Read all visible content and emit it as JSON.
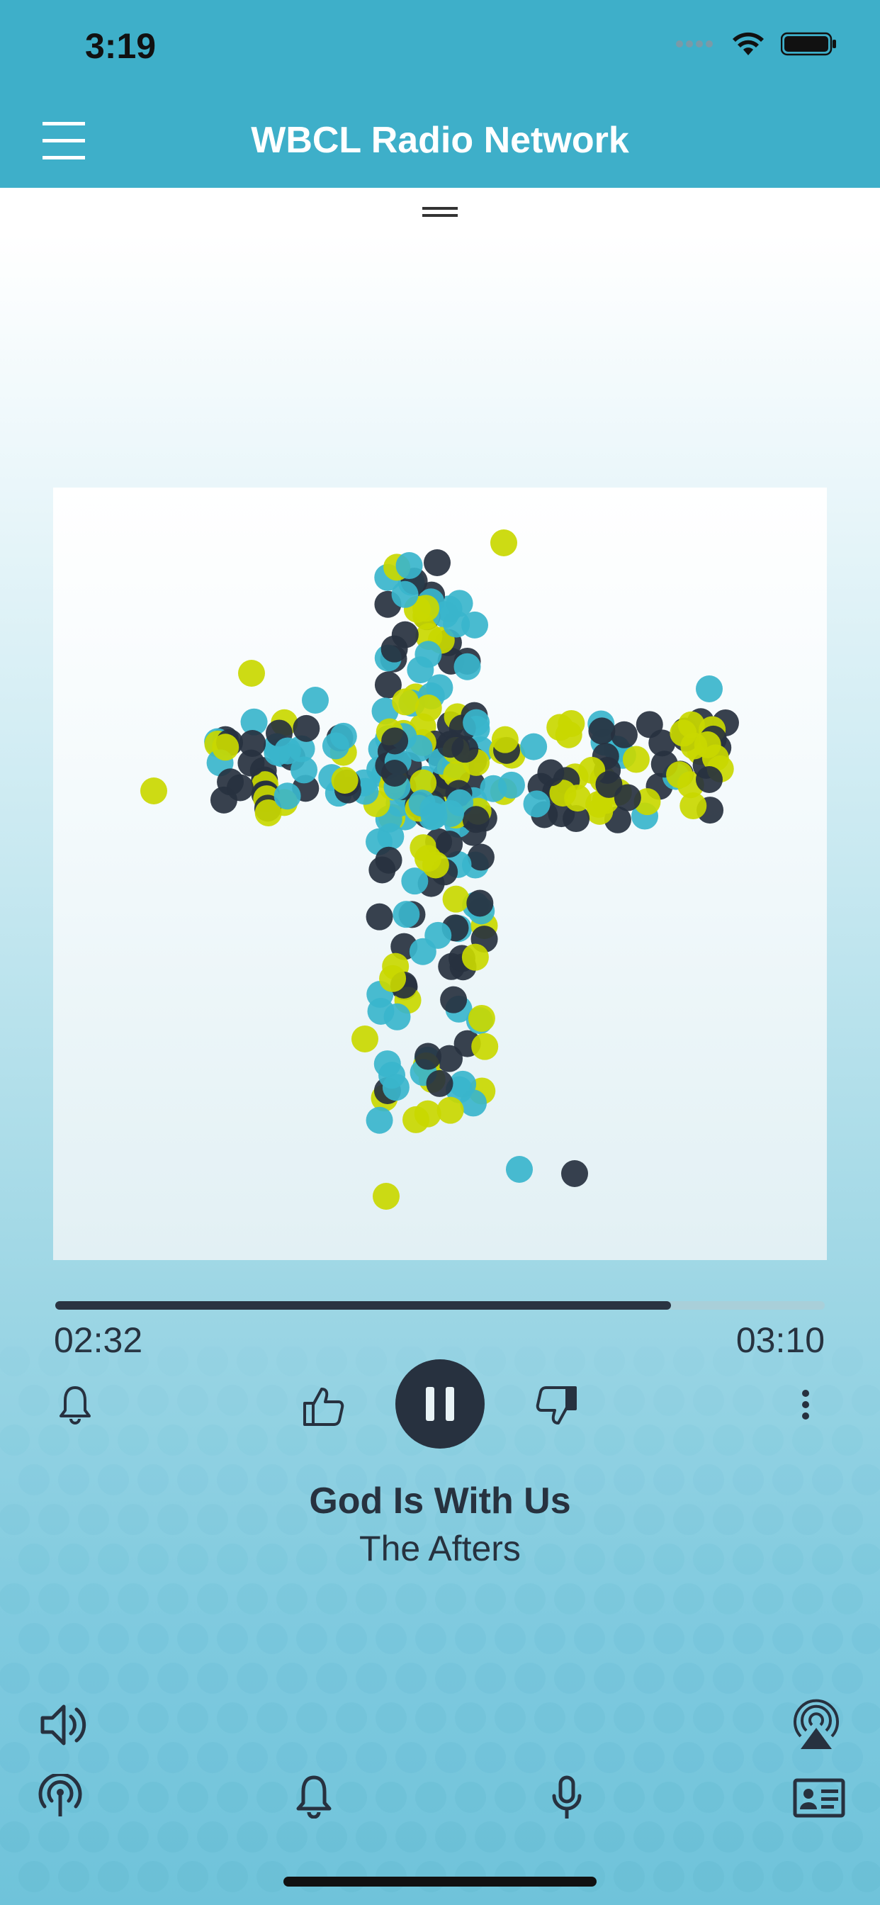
{
  "status_bar": {
    "time": "3:19"
  },
  "header": {
    "title": "WBCL Radio Network"
  },
  "player": {
    "progress_fraction": 0.8,
    "elapsed": "02:32",
    "duration": "03:10",
    "song_title": "God Is With Us",
    "artist": "The Afters"
  },
  "icons": {
    "menu": "menu-icon",
    "drag_handle": "drag-handle-icon",
    "alarm_left": "bell-icon",
    "like": "thumbs-up-icon",
    "pause": "pause-icon",
    "dislike": "thumbs-down-icon",
    "more": "more-vertical-icon",
    "volume": "speaker-icon",
    "airplay": "airplay-icon",
    "stream": "broadcast-icon",
    "alarm": "bell-icon",
    "mic": "microphone-icon",
    "contact": "contact-card-icon"
  },
  "colors": {
    "header": "#3eafc9",
    "dark": "#27313f",
    "cyan": "#3ab5cc",
    "lime": "#c9d800"
  }
}
